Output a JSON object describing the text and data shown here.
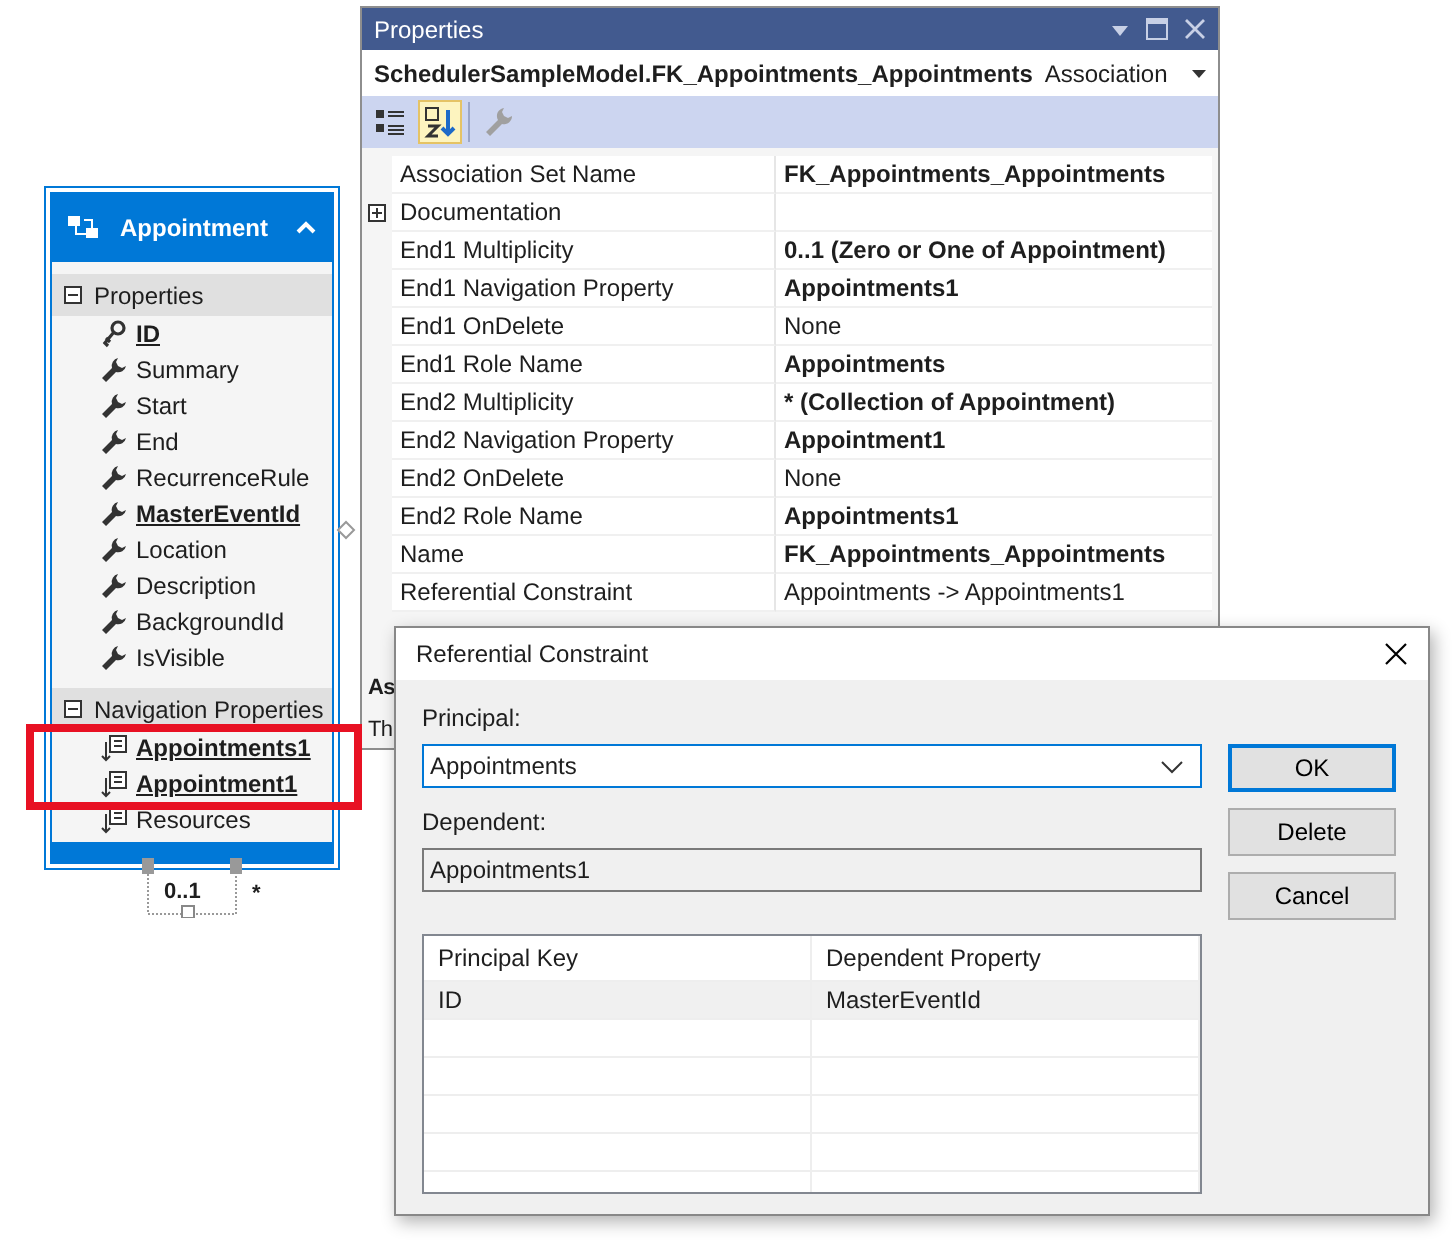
{
  "entity": {
    "title": "Appointment",
    "expanded": true,
    "sections": [
      {
        "title": "Properties",
        "expanded": true,
        "items": [
          {
            "name": "ID",
            "kind": "key",
            "bold": true,
            "highlighted": false
          },
          {
            "name": "Summary",
            "kind": "scalar",
            "bold": false,
            "highlighted": false
          },
          {
            "name": "Start",
            "kind": "scalar",
            "bold": false,
            "highlighted": false
          },
          {
            "name": "End",
            "kind": "scalar",
            "bold": false,
            "highlighted": false
          },
          {
            "name": "RecurrenceRule",
            "kind": "scalar",
            "bold": false,
            "highlighted": false
          },
          {
            "name": "MasterEventId",
            "kind": "scalar",
            "bold": true,
            "highlighted": false
          },
          {
            "name": "Location",
            "kind": "scalar",
            "bold": false,
            "highlighted": false
          },
          {
            "name": "Description",
            "kind": "scalar",
            "bold": false,
            "highlighted": false
          },
          {
            "name": "BackgroundId",
            "kind": "scalar",
            "bold": false,
            "highlighted": false
          },
          {
            "name": "IsVisible",
            "kind": "scalar",
            "bold": false,
            "highlighted": false
          }
        ]
      },
      {
        "title": "Navigation Properties",
        "expanded": true,
        "items": [
          {
            "name": "Appointments1",
            "kind": "navigation",
            "bold": true,
            "highlighted": true
          },
          {
            "name": "Appointment1",
            "kind": "navigation",
            "bold": true,
            "highlighted": true
          },
          {
            "name": "Resources",
            "kind": "navigation",
            "bold": false,
            "highlighted": false
          }
        ]
      }
    ]
  },
  "connector": {
    "end1": "0..1",
    "end2": "*"
  },
  "properties_window": {
    "title": "Properties",
    "object_name": "SchedulerSampleModel.FK_Appointments_Appointments",
    "object_type": "Association",
    "toolbar": [
      {
        "kind": "categorized",
        "selected": false,
        "disabled": false
      },
      {
        "kind": "alphabetical",
        "selected": true,
        "disabled": false
      },
      {
        "kind": "property-pages",
        "selected": false,
        "disabled": true
      }
    ],
    "rows": [
      {
        "name": "Association Set Name",
        "value": "FK_Appointments_Appointments",
        "bold": true,
        "expandable": false
      },
      {
        "name": "Documentation",
        "value": "",
        "bold": false,
        "expandable": true
      },
      {
        "name": "End1 Multiplicity",
        "value": "0..1 (Zero or One of Appointment)",
        "bold": true,
        "expandable": false
      },
      {
        "name": "End1 Navigation Property",
        "value": "Appointments1",
        "bold": true,
        "expandable": false
      },
      {
        "name": "End1 OnDelete",
        "value": "None",
        "bold": false,
        "expandable": false
      },
      {
        "name": "End1 Role Name",
        "value": "Appointments",
        "bold": true,
        "expandable": false
      },
      {
        "name": "End2 Multiplicity",
        "value": "* (Collection of Appointment)",
        "bold": true,
        "expandable": false
      },
      {
        "name": "End2 Navigation Property",
        "value": "Appointment1",
        "bold": true,
        "expandable": false
      },
      {
        "name": "End2 OnDelete",
        "value": "None",
        "bold": false,
        "expandable": false
      },
      {
        "name": "End2 Role Name",
        "value": "Appointments1",
        "bold": true,
        "expandable": false
      },
      {
        "name": "Name",
        "value": "FK_Appointments_Appointments",
        "bold": true,
        "expandable": false
      },
      {
        "name": "Referential Constraint",
        "value": "Appointments -> Appointments1",
        "bold": false,
        "expandable": false
      }
    ],
    "description": {
      "title": "As",
      "text": "Th"
    }
  },
  "dialog": {
    "title": "Referential Constraint",
    "principal": {
      "label": "Principal:",
      "value": "Appointments",
      "focused": true
    },
    "dependent": {
      "label": "Dependent:",
      "value": "Appointments1"
    },
    "table": {
      "columns": [
        "Principal Key",
        "Dependent Property"
      ],
      "rows": [
        {
          "cells": [
            "ID",
            "MasterEventId"
          ],
          "selected": true
        }
      ]
    },
    "buttons": [
      {
        "label": "OK",
        "default": true
      },
      {
        "label": "Delete",
        "default": false
      },
      {
        "label": "Cancel",
        "default": false
      }
    ]
  }
}
